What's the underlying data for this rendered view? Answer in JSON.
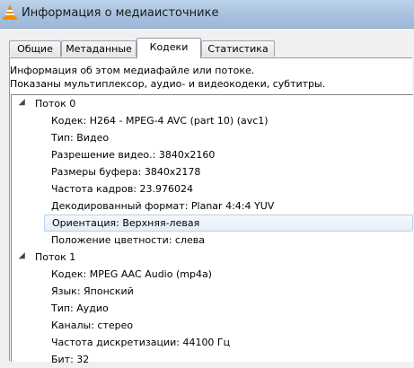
{
  "window": {
    "title": "Информация о медиаисточнике"
  },
  "tabs": [
    {
      "label": "Общие"
    },
    {
      "label": "Метаданные"
    },
    {
      "label": "Кодеки"
    },
    {
      "label": "Статистика"
    }
  ],
  "active_tab": "Кодеки",
  "description": {
    "line1": "Информация об этом медиафайле или потоке.",
    "line2": "Показаны мультиплексор, аудио- и видеокодеки, субтитры."
  },
  "streams": [
    {
      "label": "Поток 0",
      "fields": [
        "Кодек: H264 - MPEG-4 AVC (part 10) (avc1)",
        "Тип: Видео",
        "Разрешение видео.: 3840x2160",
        "Размеры буфера: 3840x2178",
        "Частота кадров: 23.976024",
        "Декодированный формат: Planar 4:4:4 YUV",
        "Ориентация: Верхняя-левая",
        "Положение цветности: слева"
      ]
    },
    {
      "label": "Поток 1",
      "fields": [
        "Кодек: MPEG AAC Audio (mp4a)",
        "Язык: Японский",
        "Тип: Аудио",
        "Каналы: стерео",
        "Частота дискретизации: 44100 Гц",
        "Бит: 32"
      ]
    }
  ],
  "selected_field": "Ориентация: Верхняя-левая"
}
